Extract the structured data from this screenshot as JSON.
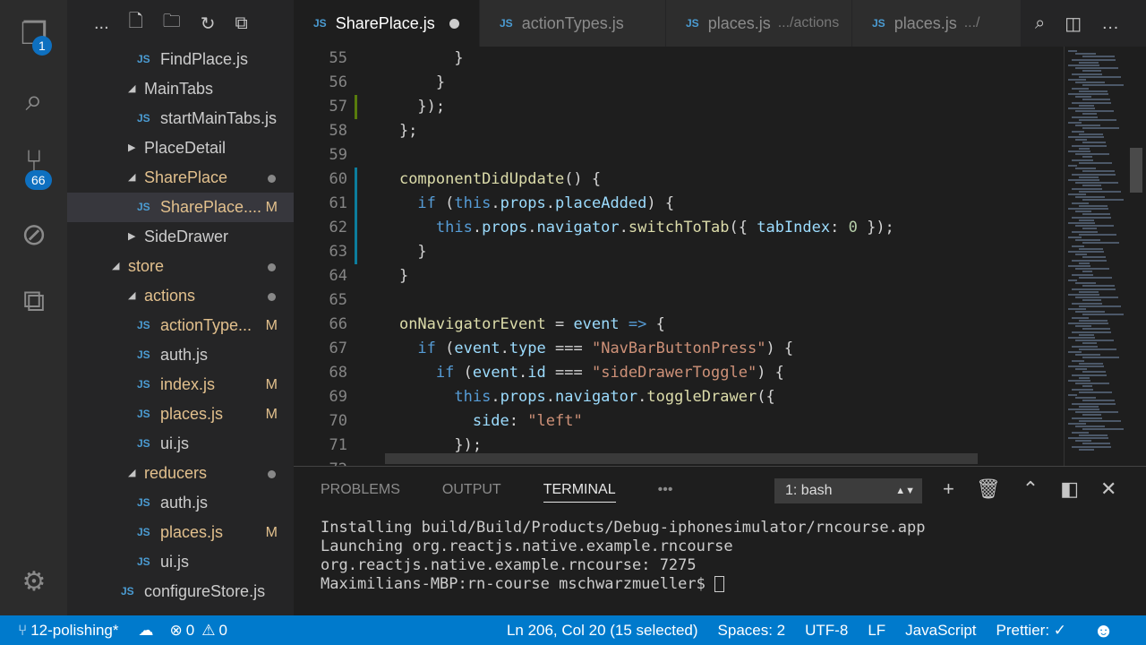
{
  "activity": {
    "explorer_badge": "1",
    "scm_badge": "66"
  },
  "sidebar": {
    "toolbar_more": "...",
    "items": [
      {
        "label": "FindPlace.js",
        "type": "file",
        "depth": 3
      },
      {
        "label": "MainTabs",
        "type": "folder",
        "depth": 2,
        "open": true
      },
      {
        "label": "startMainTabs.js",
        "type": "file",
        "depth": 3
      },
      {
        "label": "PlaceDetail",
        "type": "folder",
        "depth": 2,
        "open": false
      },
      {
        "label": "SharePlace",
        "type": "folder",
        "depth": 2,
        "open": true,
        "modified": true,
        "dot": true
      },
      {
        "label": "SharePlace....",
        "type": "file",
        "depth": 3,
        "modified": true,
        "status": "M",
        "selected": true
      },
      {
        "label": "SideDrawer",
        "type": "folder",
        "depth": 2,
        "open": false
      },
      {
        "label": "store",
        "type": "folder",
        "depth": 1,
        "open": true,
        "modified": true,
        "dot": true
      },
      {
        "label": "actions",
        "type": "folder",
        "depth": 2,
        "open": true,
        "modified": true,
        "dot": true
      },
      {
        "label": "actionType...",
        "type": "file",
        "depth": 3,
        "modified": true,
        "status": "M"
      },
      {
        "label": "auth.js",
        "type": "file",
        "depth": 3
      },
      {
        "label": "index.js",
        "type": "file",
        "depth": 3,
        "modified": true,
        "status": "M"
      },
      {
        "label": "places.js",
        "type": "file",
        "depth": 3,
        "modified": true,
        "status": "M"
      },
      {
        "label": "ui.js",
        "type": "file",
        "depth": 3
      },
      {
        "label": "reducers",
        "type": "folder",
        "depth": 2,
        "open": true,
        "modified": true,
        "dot": true
      },
      {
        "label": "auth.js",
        "type": "file",
        "depth": 3
      },
      {
        "label": "places.js",
        "type": "file",
        "depth": 3,
        "modified": true,
        "status": "M"
      },
      {
        "label": "ui.js",
        "type": "file",
        "depth": 3
      },
      {
        "label": "configureStore.js",
        "type": "file",
        "depth": 2
      }
    ]
  },
  "tabs": [
    {
      "label": "SharePlace.js",
      "active": true,
      "dirty": true
    },
    {
      "label": "actionTypes.js"
    },
    {
      "label": "places.js",
      "desc": ".../actions"
    },
    {
      "label": "places.js",
      "desc": ".../"
    }
  ],
  "editor": {
    "lines": [
      {
        "n": "55",
        "t": [
          [
            "          }",
            "pl"
          ]
        ]
      },
      {
        "n": "56",
        "t": [
          [
            "        }",
            "pl"
          ]
        ]
      },
      {
        "n": "57",
        "g": "#587c0c",
        "t": [
          [
            "      });",
            "pl"
          ]
        ]
      },
      {
        "n": "58",
        "t": [
          [
            "    };",
            "pl"
          ]
        ]
      },
      {
        "n": "59",
        "t": []
      },
      {
        "n": "60",
        "g": "#0c7d9d",
        "t": [
          [
            "    ",
            "pl"
          ],
          [
            "componentDidUpdate",
            "fn"
          ],
          [
            "() {",
            "pl"
          ]
        ]
      },
      {
        "n": "61",
        "g": "#0c7d9d",
        "t": [
          [
            "      ",
            "pl"
          ],
          [
            "if",
            "kw"
          ],
          [
            " (",
            "pl"
          ],
          [
            "this",
            "kw"
          ],
          [
            ".",
            "pl"
          ],
          [
            "props",
            "pr"
          ],
          [
            ".",
            "pl"
          ],
          [
            "placeAdded",
            "pr"
          ],
          [
            ") {",
            "pl"
          ]
        ]
      },
      {
        "n": "62",
        "g": "#0c7d9d",
        "t": [
          [
            "        ",
            "pl"
          ],
          [
            "this",
            "kw"
          ],
          [
            ".",
            "pl"
          ],
          [
            "props",
            "pr"
          ],
          [
            ".",
            "pl"
          ],
          [
            "navigator",
            "pr"
          ],
          [
            ".",
            "pl"
          ],
          [
            "switchToTab",
            "fn"
          ],
          [
            "({ ",
            "pl"
          ],
          [
            "tabIndex",
            "pr"
          ],
          [
            ": ",
            "pl"
          ],
          [
            "0",
            "nm"
          ],
          [
            " });",
            "pl"
          ]
        ]
      },
      {
        "n": "63",
        "g": "#0c7d9d",
        "t": [
          [
            "      }",
            "pl"
          ]
        ]
      },
      {
        "n": "64",
        "t": [
          [
            "    }",
            "pl"
          ]
        ]
      },
      {
        "n": "65",
        "t": []
      },
      {
        "n": "66",
        "t": [
          [
            "    ",
            "pl"
          ],
          [
            "onNavigatorEvent",
            "fn"
          ],
          [
            " = ",
            "pl"
          ],
          [
            "event",
            "pr"
          ],
          [
            " ",
            "pl"
          ],
          [
            "=>",
            "kw"
          ],
          [
            " {",
            "pl"
          ]
        ]
      },
      {
        "n": "67",
        "t": [
          [
            "      ",
            "pl"
          ],
          [
            "if",
            "kw"
          ],
          [
            " (",
            "pl"
          ],
          [
            "event",
            "pr"
          ],
          [
            ".",
            "pl"
          ],
          [
            "type",
            "pr"
          ],
          [
            " === ",
            "pl"
          ],
          [
            "\"NavBarButtonPress\"",
            "str"
          ],
          [
            ") {",
            "pl"
          ]
        ]
      },
      {
        "n": "68",
        "t": [
          [
            "        ",
            "pl"
          ],
          [
            "if",
            "kw"
          ],
          [
            " (",
            "pl"
          ],
          [
            "event",
            "pr"
          ],
          [
            ".",
            "pl"
          ],
          [
            "id",
            "pr"
          ],
          [
            " === ",
            "pl"
          ],
          [
            "\"sideDrawerToggle\"",
            "str"
          ],
          [
            ") {",
            "pl"
          ]
        ]
      },
      {
        "n": "69",
        "t": [
          [
            "          ",
            "pl"
          ],
          [
            "this",
            "kw"
          ],
          [
            ".",
            "pl"
          ],
          [
            "props",
            "pr"
          ],
          [
            ".",
            "pl"
          ],
          [
            "navigator",
            "pr"
          ],
          [
            ".",
            "pl"
          ],
          [
            "toggleDrawer",
            "fn"
          ],
          [
            "({",
            "pl"
          ]
        ]
      },
      {
        "n": "70",
        "t": [
          [
            "            ",
            "pl"
          ],
          [
            "side",
            "pr"
          ],
          [
            ": ",
            "pl"
          ],
          [
            "\"left\"",
            "str"
          ]
        ]
      },
      {
        "n": "71",
        "t": [
          [
            "          });",
            "pl"
          ]
        ]
      }
    ]
  },
  "panel": {
    "tabs": [
      "PROBLEMS",
      "OUTPUT",
      "TERMINAL"
    ],
    "active": "TERMINAL",
    "more": "•••",
    "terminal_select": "1: bash",
    "terminal_lines": [
      "Installing build/Build/Products/Debug-iphonesimulator/rncourse.app",
      "Launching org.reactjs.native.example.rncourse",
      "org.reactjs.native.example.rncourse: 7275",
      "Maximilians-MBP:rn-course mschwarzmueller$ "
    ]
  },
  "status": {
    "branch": "12-polishing*",
    "errors": "0",
    "warnings": "0",
    "position": "Ln 206, Col 20 (15 selected)",
    "spaces": "Spaces: 2",
    "encoding": "UTF-8",
    "eol": "LF",
    "language": "JavaScript",
    "prettier": "Prettier: ✓"
  },
  "colors": {
    "status_bar": "#007acc",
    "modified": "#e2c08d",
    "badge": "#0e70c0"
  }
}
